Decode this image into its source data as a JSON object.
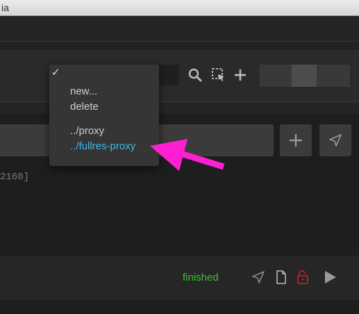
{
  "window": {
    "title_fragment": "ia"
  },
  "toolbar": {
    "icons": [
      "magnifier-icon",
      "select-region-icon",
      "plus-icon"
    ]
  },
  "input": {
    "resolution_fragment": "2160]",
    "add_icon": "plus-icon",
    "send_icon": "send-arrow-icon"
  },
  "job": {
    "status": "finished",
    "status_color": "#3fbf3f",
    "icons": [
      "send-arrow-icon",
      "document-icon",
      "unlock-icon",
      "play-icon"
    ]
  },
  "dropdown": {
    "checkmark": "✓",
    "items": [
      {
        "label": "new...",
        "active": false
      },
      {
        "label": "delete",
        "active": false
      },
      {
        "label": "../proxy",
        "active": false
      },
      {
        "label": "../fullres-proxy",
        "active": true
      }
    ],
    "active_color": "#3fb7e6",
    "annotation_color": "#ff1fd3"
  }
}
